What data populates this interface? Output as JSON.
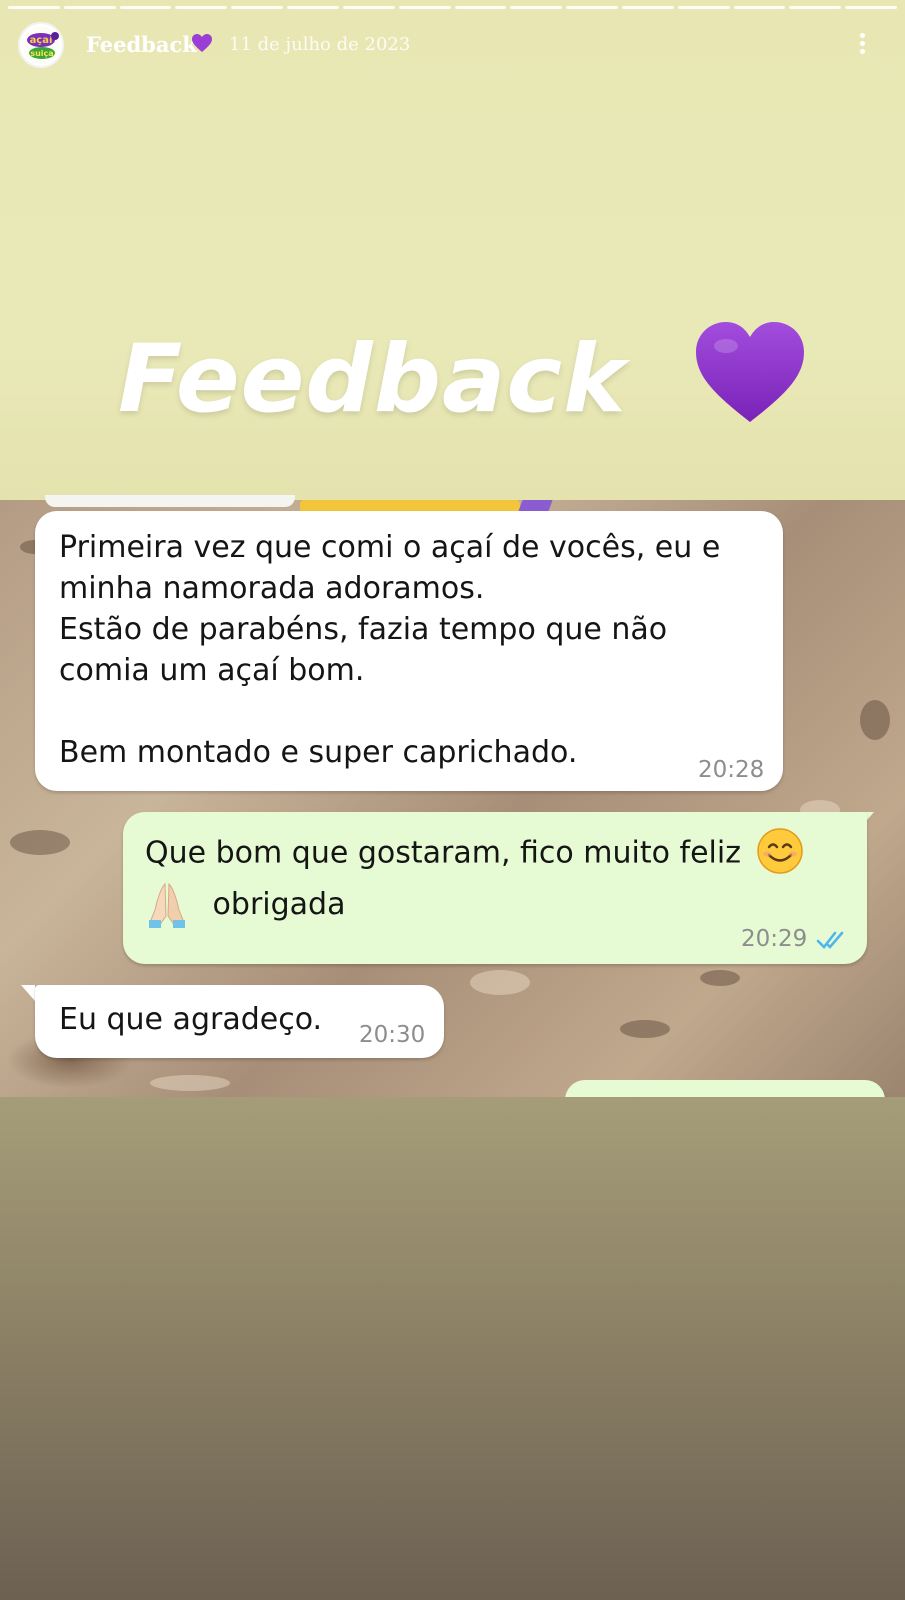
{
  "story": {
    "progress_segments": 16,
    "author": "Feedback",
    "date": "11 de julho de 2023",
    "avatar_icon": "acai-da-suica-logo",
    "menu_icon": "more-vertical-icon"
  },
  "hero": {
    "title": "Feedback",
    "heart_icon": "purple-heart-icon",
    "heart_color": "#8a2fc9"
  },
  "chat": {
    "messages": [
      {
        "direction": "incoming",
        "lines": [
          "Primeira vez que comi o açaí de vocês, eu e",
          "minha namorada adoramos.",
          "Estão de parabéns, fazia tempo que não",
          "comia um açaí bom.",
          "",
          "Bem montado e super caprichado."
        ],
        "time": "20:28"
      },
      {
        "direction": "outgoing",
        "line1": "Que bom que gostaram, fico muito feliz",
        "line1_emoji": "smiling-face-icon",
        "line2_emoji": "folded-hands-icon",
        "line2": "obrigada",
        "time": "20:29",
        "status_icon": "double-check-icon"
      },
      {
        "direction": "incoming",
        "text": "Eu que agradeço.",
        "time": "20:30"
      }
    ]
  },
  "colors": {
    "incoming_bubble": "#ffffff",
    "outgoing_bubble": "#e6fbd4",
    "read_ticks": "#4fb6ec",
    "story_top": "#e8e7b4"
  }
}
